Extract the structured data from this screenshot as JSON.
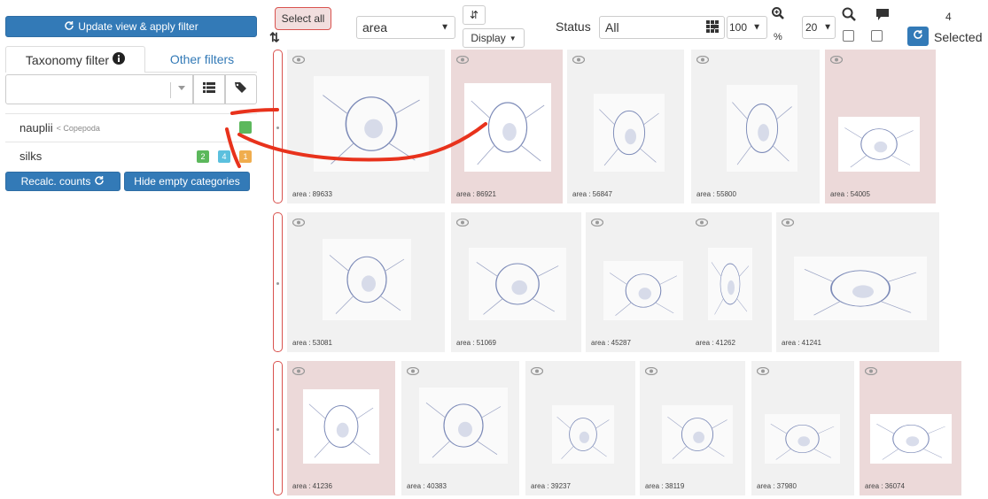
{
  "left_panel": {
    "update_button": "Update view & apply filter",
    "taxonomy_tab": "Taxonomy filter",
    "other_filters_tab": "Other filters",
    "categories": [
      {
        "name": "nauplii",
        "parent": "< Copepoda",
        "badges": []
      },
      {
        "name": "silks",
        "parent": "",
        "badges": [
          "2",
          "4",
          "1"
        ]
      }
    ],
    "recalc_button": "Recalc. counts",
    "hide_empty_button": "Hide empty categories"
  },
  "toolbar": {
    "select_all": "Select all",
    "sort_field": "area",
    "display_button": "Display",
    "status_label": "Status",
    "status_value": "All",
    "page_size": "100",
    "zoom_pct_label": "%",
    "zoom_value": "20",
    "selected_count": "4",
    "selected_label": "Selected"
  },
  "vignettes": [
    {
      "label": "area : 89633",
      "selected": false
    },
    {
      "label": "area : 86921",
      "selected": true
    },
    {
      "label": "area : 56847",
      "selected": false
    },
    {
      "label": "area : 55800",
      "selected": false
    },
    {
      "label": "area : 54005",
      "selected": true
    },
    {
      "label": "area : 53081",
      "selected": false
    },
    {
      "label": "area : 51069",
      "selected": false
    },
    {
      "label": "area : 45287",
      "selected": false
    },
    {
      "label": "area : 41262",
      "selected": false
    },
    {
      "label": "area : 41241",
      "selected": false
    },
    {
      "label": "area : 41236",
      "selected": true
    },
    {
      "label": "area : 40383",
      "selected": false
    },
    {
      "label": "area : 39237",
      "selected": false
    },
    {
      "label": "area : 38119",
      "selected": false
    },
    {
      "label": "area : 37980",
      "selected": false
    },
    {
      "label": "area : 36074",
      "selected": true
    }
  ],
  "colors": {
    "primary": "#337ab7",
    "selected_bg": "#ecd9d9",
    "danger": "#d9534f",
    "annotation": "#e8321c"
  }
}
